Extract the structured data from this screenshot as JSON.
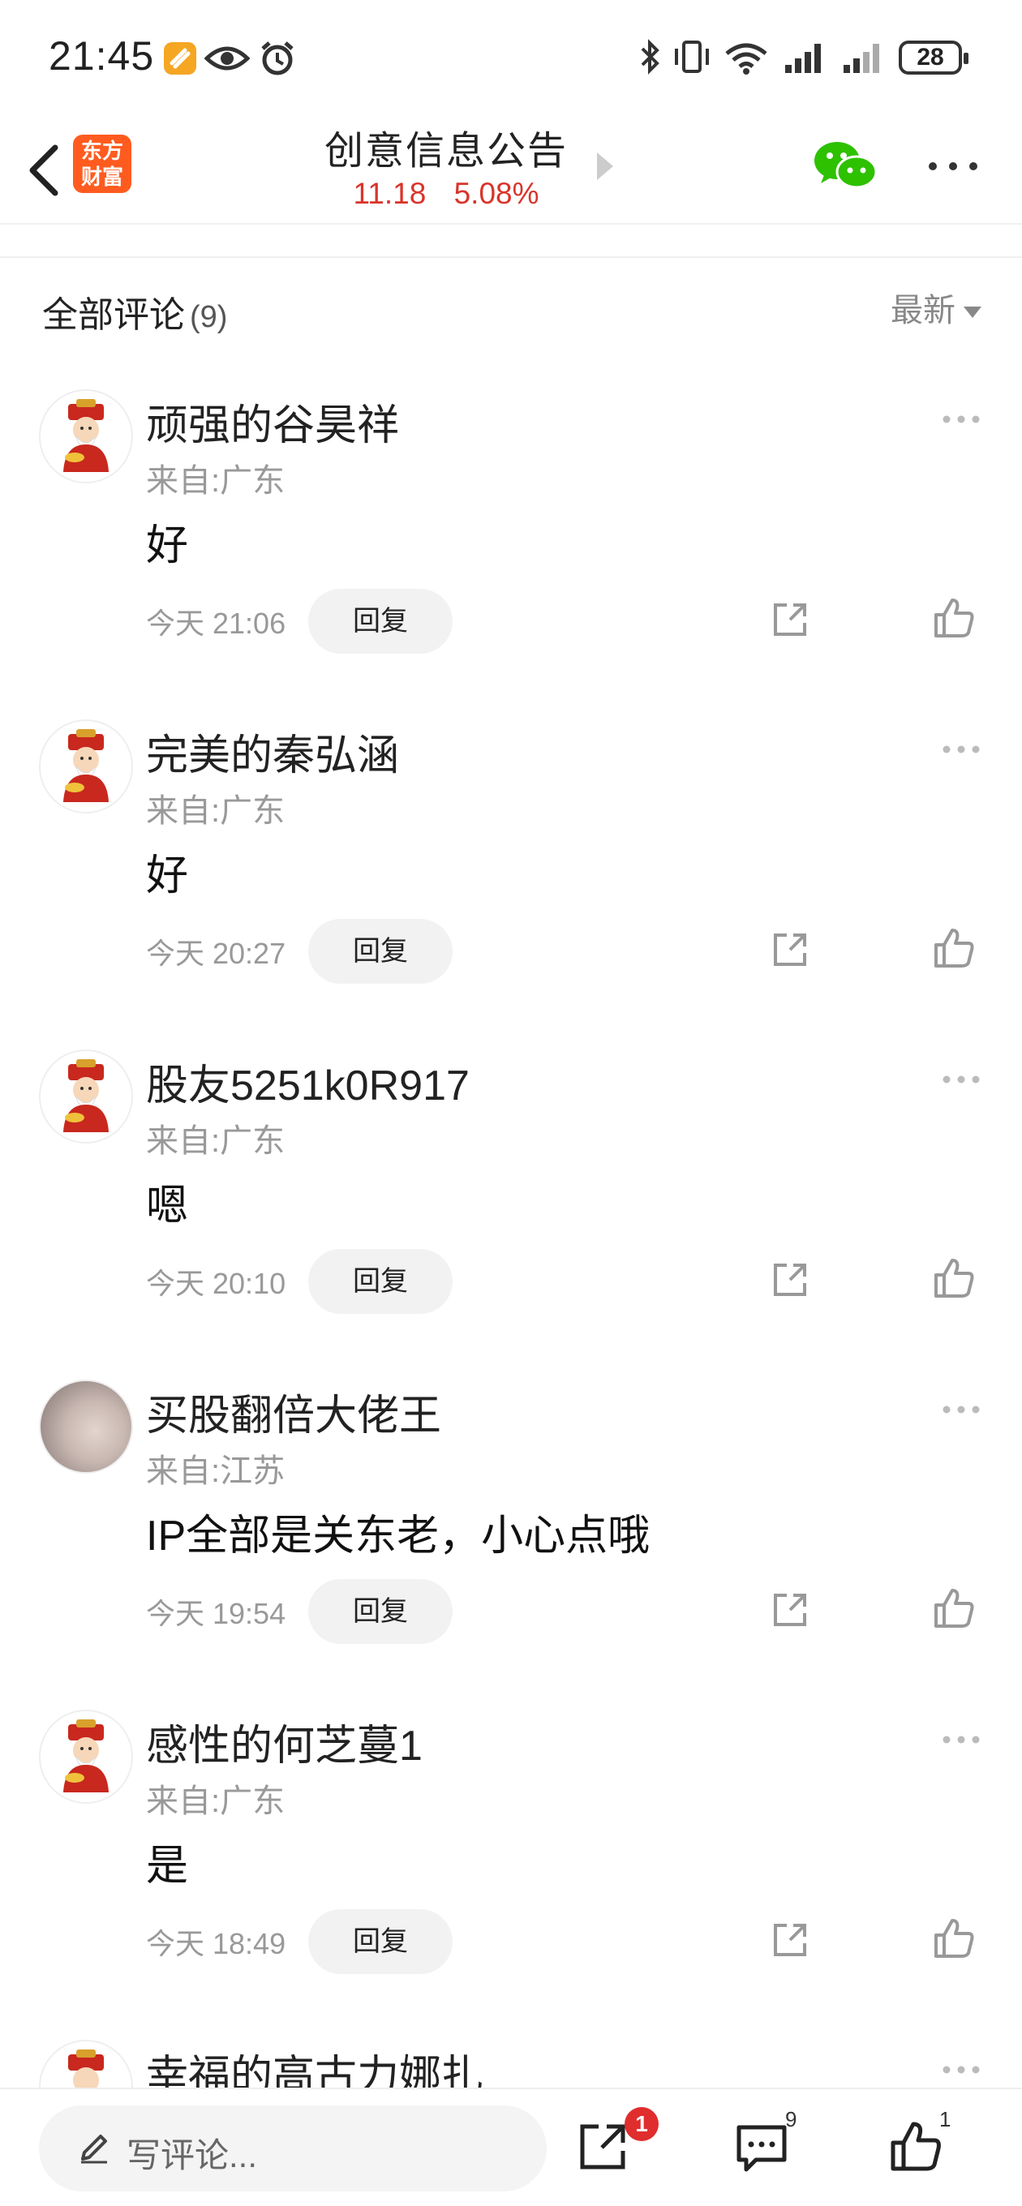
{
  "status_bar": {
    "time": "21:45",
    "battery": "28",
    "icons": [
      "app-badge-icon",
      "eye-icon",
      "alarm-icon",
      "bluetooth-icon",
      "vibrate-icon",
      "wifi-icon",
      "signal-icon",
      "signal-icon"
    ]
  },
  "header": {
    "logo_line1": "东方",
    "logo_line2": "财富",
    "title": "创意信息公告",
    "price": "11.18",
    "change": "5.08%",
    "colors": {
      "brand": "#ff5b1f",
      "up": "#d9342b",
      "wechat": "#2dc100"
    }
  },
  "section": {
    "title": "全部评论",
    "count": "(9)",
    "sort_label": "最新"
  },
  "comments": [
    {
      "user": "顽强的谷昊祥",
      "location": "来自:广东",
      "text": "好",
      "time": "今天 21:06",
      "reply": "回复",
      "avatar": "god-of-wealth"
    },
    {
      "user": "完美的秦弘涵",
      "location": "来自:广东",
      "text": "好",
      "time": "今天 20:27",
      "reply": "回复",
      "avatar": "god-of-wealth"
    },
    {
      "user": "股友5251k0R917",
      "location": "来自:广东",
      "text": "嗯",
      "time": "今天 20:10",
      "reply": "回复",
      "avatar": "god-of-wealth"
    },
    {
      "user": "买股翻倍大佬王",
      "location": "来自:江苏",
      "text": "IP全部是关东老，小心点哦",
      "time": "今天 19:54",
      "reply": "回复",
      "avatar": "photo"
    },
    {
      "user": "感性的何芝蔓1",
      "location": "来自:广东",
      "text": "是",
      "time": "今天 18:49",
      "reply": "回复",
      "avatar": "god-of-wealth"
    },
    {
      "user": "幸福的高古力娜扎",
      "location": "",
      "text": "",
      "time": "",
      "reply": "",
      "avatar": "god-of-wealth"
    }
  ],
  "bottom_bar": {
    "placeholder": "写评论...",
    "share_badge": "1",
    "comment_count": "9",
    "like_count": "1"
  }
}
